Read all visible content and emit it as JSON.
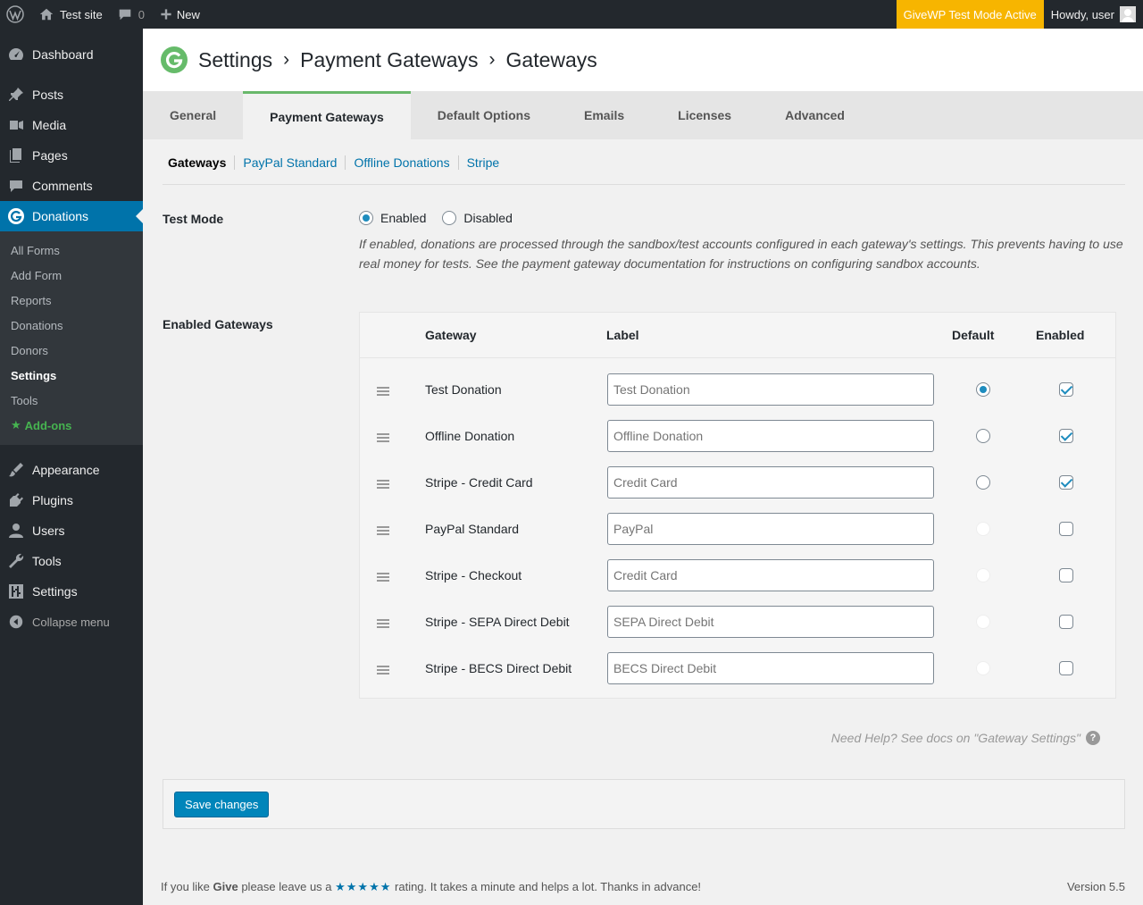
{
  "adminbar": {
    "site_name": "Test site",
    "comments_count": "0",
    "new_label": "New",
    "test_mode_notice": "GiveWP Test Mode Active",
    "howdy": "Howdy, user"
  },
  "sidebar": {
    "items_top": [
      {
        "label": "Dashboard",
        "icon": "dashboard-icon"
      },
      {
        "label": "Posts",
        "icon": "pin-icon"
      },
      {
        "label": "Media",
        "icon": "media-icon"
      },
      {
        "label": "Pages",
        "icon": "pages-icon"
      },
      {
        "label": "Comments",
        "icon": "comment-icon"
      },
      {
        "label": "Donations",
        "icon": "give-icon"
      }
    ],
    "submenu": [
      "All Forms",
      "Add Form",
      "Reports",
      "Donations",
      "Donors",
      "Settings",
      "Tools",
      "Add-ons"
    ],
    "items_bottom": [
      {
        "label": "Appearance",
        "icon": "brush-icon"
      },
      {
        "label": "Plugins",
        "icon": "plugin-icon"
      },
      {
        "label": "Users",
        "icon": "user-icon"
      },
      {
        "label": "Tools",
        "icon": "wrench-icon"
      },
      {
        "label": "Settings",
        "icon": "sliders-icon"
      }
    ],
    "collapse_label": "Collapse menu"
  },
  "header": {
    "crumbs": [
      "Settings",
      "Payment Gateways",
      "Gateways"
    ],
    "separator": "›"
  },
  "tabs": [
    "General",
    "Payment Gateways",
    "Default Options",
    "Emails",
    "Licenses",
    "Advanced"
  ],
  "subnav": [
    "Gateways",
    "PayPal Standard",
    "Offline Donations",
    "Stripe"
  ],
  "test_mode": {
    "label": "Test Mode",
    "enabled_label": "Enabled",
    "disabled_label": "Disabled",
    "selected": "Enabled",
    "description": "If enabled, donations are processed through the sandbox/test accounts configured in each gateway's settings. This prevents having to use real money for tests. See the payment gateway documentation for instructions on configuring sandbox accounts."
  },
  "gateways": {
    "label": "Enabled Gateways",
    "columns": {
      "gateway": "Gateway",
      "label": "Label",
      "default": "Default",
      "enabled": "Enabled"
    },
    "rows": [
      {
        "name": "Test Donation",
        "label": "Test Donation",
        "default": "checked",
        "enabled": true
      },
      {
        "name": "Offline Donation",
        "label": "Offline Donation",
        "default": "unchecked",
        "enabled": true
      },
      {
        "name": "Stripe - Credit Card",
        "label": "Credit Card",
        "default": "unchecked",
        "enabled": true
      },
      {
        "name": "PayPal Standard",
        "label": "PayPal",
        "default": "disabled",
        "enabled": false
      },
      {
        "name": "Stripe - Checkout",
        "label": "Credit Card",
        "default": "disabled",
        "enabled": false
      },
      {
        "name": "Stripe - SEPA Direct Debit",
        "label": "SEPA Direct Debit",
        "default": "disabled",
        "enabled": false
      },
      {
        "name": "Stripe - BECS Direct Debit",
        "label": "BECS Direct Debit",
        "default": "disabled",
        "enabled": false
      }
    ]
  },
  "help_text": "Need Help? See docs on \"Gateway Settings\"",
  "help_icon": "?",
  "save_label": "Save changes",
  "footer": {
    "pre": "If you like ",
    "brand": "Give",
    "mid": " please leave us a ",
    "stars": "★★★★★",
    "post": " rating. It takes a minute and helps a lot. Thanks in advance!",
    "version": "Version 5.5"
  },
  "colors": {
    "accent": "#0073aa",
    "test_mode_bg": "#f7b500",
    "tab_active_border": "#69b86b",
    "give_green": "#66bb6a"
  }
}
